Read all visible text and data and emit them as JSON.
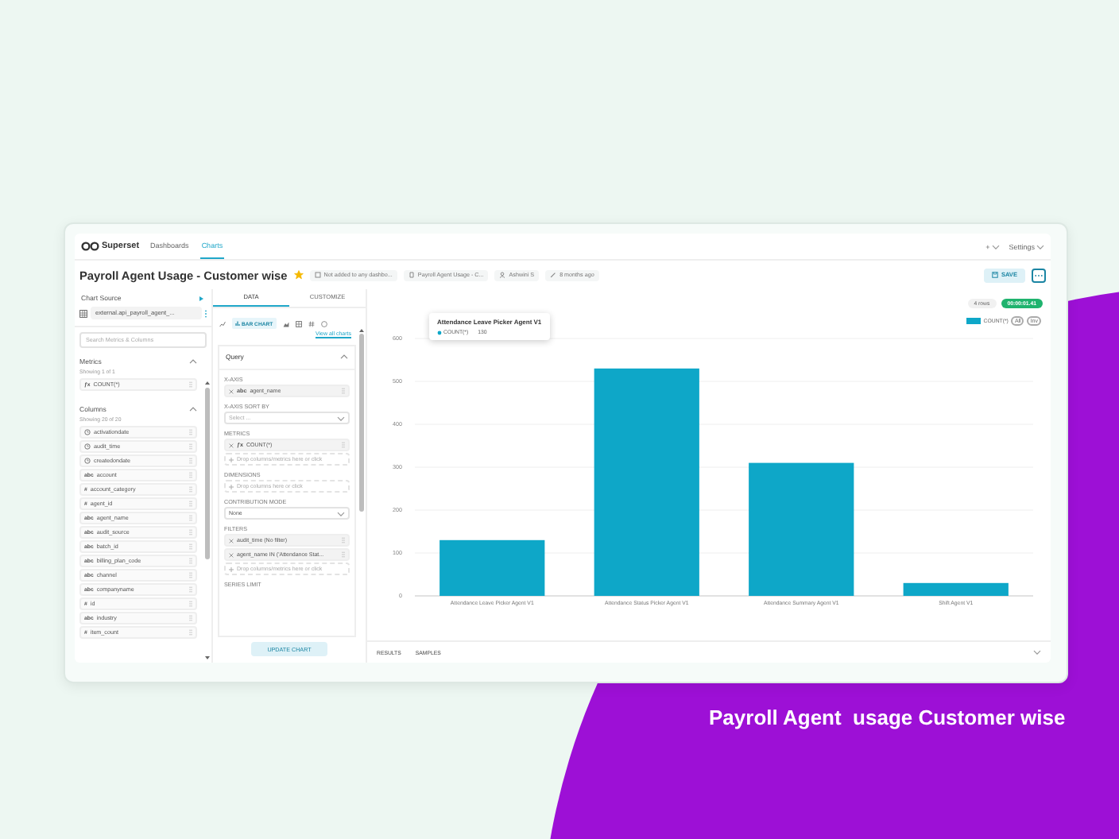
{
  "nav": {
    "logo": "Superset",
    "links": [
      {
        "label": "Dashboards",
        "selected": false
      },
      {
        "label": "Charts",
        "selected": true
      }
    ],
    "plus": "+",
    "settings": "Settings"
  },
  "header": {
    "title": "Payroll Agent Usage - Customer wise",
    "favorite": true,
    "meta": [
      {
        "kind": "dashboards",
        "text": "Not added to any dashbo..."
      },
      {
        "kind": "report",
        "text": "Payroll Agent Usage - C..."
      },
      {
        "kind": "owner",
        "text": "Ashwini S"
      },
      {
        "kind": "modified",
        "text": "8 months ago"
      }
    ],
    "save": "SAVE"
  },
  "source": {
    "heading": "Chart Source",
    "dataset": "external.api_payroll_agent_...",
    "search_placeholder": "Search Metrics & Columns",
    "metrics": {
      "title": "Metrics",
      "expanded": true,
      "count": "Showing 1 of 1",
      "items": [
        {
          "kind": "badge",
          "badge": "ƒx",
          "name": "COUNT(*)"
        }
      ]
    },
    "columns": {
      "title": "Columns",
      "expanded": true,
      "count": "Showing 20 of 20",
      "items": [
        {
          "kind": "time",
          "name": "activationdate"
        },
        {
          "kind": "time",
          "name": "audit_time"
        },
        {
          "kind": "time",
          "name": "createdondate"
        },
        {
          "kind": "badge",
          "badge": "abc",
          "name": "account"
        },
        {
          "kind": "badge",
          "badge": "#",
          "name": "account_category"
        },
        {
          "kind": "badge",
          "badge": "#",
          "name": "agent_id"
        },
        {
          "kind": "badge",
          "badge": "abc",
          "name": "agent_name"
        },
        {
          "kind": "badge",
          "badge": "abc",
          "name": "audit_source"
        },
        {
          "kind": "badge",
          "badge": "abc",
          "name": "batch_id"
        },
        {
          "kind": "badge",
          "badge": "abc",
          "name": "billing_plan_code"
        },
        {
          "kind": "badge",
          "badge": "abc",
          "name": "channel"
        },
        {
          "kind": "badge",
          "badge": "abc",
          "name": "companyname"
        },
        {
          "kind": "badge",
          "badge": "#",
          "name": "id"
        },
        {
          "kind": "badge",
          "badge": "abc",
          "name": "industry"
        },
        {
          "kind": "badge",
          "badge": "#",
          "name": "item_count"
        }
      ]
    }
  },
  "controls": {
    "tabs": [
      {
        "label": "DATA",
        "selected": true
      },
      {
        "label": "CUSTOMIZE",
        "selected": false
      }
    ],
    "viz_type": "BAR CHART",
    "view_all": "View all charts",
    "query": {
      "title": "Query",
      "expanded": true,
      "fields": [
        {
          "kind": "chips",
          "label": "X-AXIS",
          "chips": [
            {
              "badge": "abc",
              "text": "agent_name"
            }
          ]
        },
        {
          "kind": "select",
          "label": "X-AXIS SORT BY",
          "placeholder": "Select ..."
        },
        {
          "kind": "chips",
          "label": "METRICS",
          "chips": [
            {
              "badge": "ƒx",
              "text": "COUNT(*)"
            }
          ],
          "drop": "Drop columns/metrics here or click"
        },
        {
          "kind": "drop",
          "label": "DIMENSIONS",
          "drop": "Drop columns here or click"
        },
        {
          "kind": "select",
          "label": "CONTRIBUTION MODE",
          "value": "None"
        },
        {
          "kind": "chips",
          "label": "FILTERS",
          "chips": [
            {
              "text": "audit_time (No filter)"
            },
            {
              "text": "agent_name IN ('Attendance Stat..."
            }
          ],
          "drop": "Drop columns/metrics here or click"
        },
        {
          "kind": "label",
          "label": "SERIES LIMIT"
        }
      ]
    },
    "update_button": "UPDATE CHART"
  },
  "chart": {
    "rows": "4 rows",
    "timer": "00:00:01.41",
    "legend": {
      "all": "All",
      "inv": "Inv"
    },
    "tooltip": {
      "title": "Attendance Leave Picker Agent V1",
      "series": "COUNT(*)",
      "value": "130"
    },
    "chart_data": {
      "type": "bar",
      "categories": [
        "Attendance Leave Picker Agent V1",
        "Attendance Status Picker Agent V1",
        "Attendance Summary Agent V1",
        "Shift Agent V1"
      ],
      "series": [
        {
          "name": "COUNT(*)",
          "color": "#0ea7c8",
          "values": [
            130,
            530,
            310,
            30
          ]
        }
      ],
      "ylim": [
        0,
        600
      ],
      "grid": true,
      "yticks": [
        0,
        100,
        200,
        300,
        400,
        500,
        600
      ]
    },
    "bottom_tabs": [
      "RESULTS",
      "SAMPLES"
    ]
  },
  "caption": "Payroll Agent  usage Customer wise"
}
